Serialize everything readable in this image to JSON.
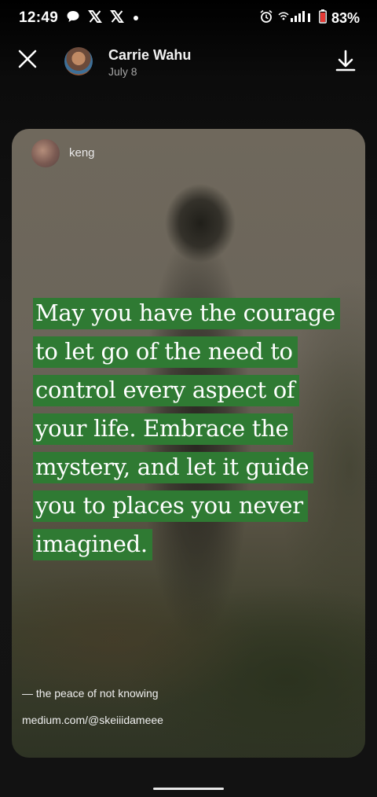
{
  "status_bar": {
    "time": "12:49",
    "battery": "83%",
    "icons_left": [
      "chat-bubble-icon",
      "x-logo-icon",
      "x-logo-icon",
      "dot-icon"
    ],
    "icons_right": [
      "alarm-icon",
      "wifi-signal-icon",
      "battery-icon"
    ]
  },
  "header": {
    "owner_name": "Carrie Wahu",
    "date": "July 8"
  },
  "card": {
    "username": "keng",
    "quote_lines": [
      "May you have the courage",
      "to let go of the need to",
      "control every aspect of",
      "your life. Embrace the",
      "mystery, and let it guide",
      "you to places you never",
      "imagined."
    ],
    "source": "— the peace of not knowing",
    "link": "medium.com/@skeiiidameee",
    "highlight_color": "#2f7a33"
  }
}
